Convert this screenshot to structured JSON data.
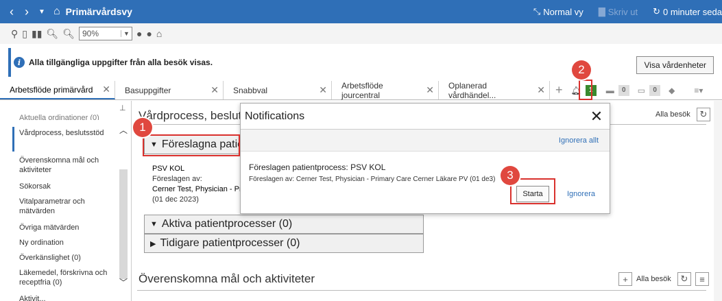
{
  "titlebar": {
    "title": "Primärvårdsvy",
    "normal_view": "Normal vy",
    "print": "Skriv ut",
    "refresh": "0 minuter seda"
  },
  "toolbar": {
    "zoom": "90%"
  },
  "banner": {
    "text": "Alla tillgängliga uppgifter från alla besök visas.",
    "button": "Visa vårdenheter"
  },
  "tabs": [
    {
      "label": "Arbetsflöde primärvård"
    },
    {
      "label": "Basuppgifter"
    },
    {
      "label": "Snabbval"
    },
    {
      "label": "Arbetsflöde jourcentral"
    },
    {
      "label": "Oplanerad vårdhändel..."
    }
  ],
  "tab_counts": {
    "notifications": "1",
    "messages": "0",
    "inbox": "0"
  },
  "sidebar": {
    "items": [
      "Aktuella ordinationer (0)",
      "Vårdprocess, beslutsstöd",
      "Överenskomna mål och aktiviteter",
      "Sökorsak",
      "Vitalparametrar och mätvärden",
      "Övriga mätvärden",
      "Ny ordination",
      "Överkänslighet (0)",
      "Läkemedel, förskrivna och receptfria (0)",
      "Aktivit..."
    ]
  },
  "main": {
    "heading": "Vårdprocess, besluts",
    "alla_besok": "Alla besök",
    "section_suggested": "Föreslagna patie",
    "proposal_name": "PSV KOL",
    "proposal_by_label": "Föreslagen av:",
    "proposal_by": "Cerner Test, Physician - Pri",
    "proposal_date": "(01 dec 2023)",
    "section_active": "Aktiva patientprocesser (0)",
    "section_previous": "Tidigare patientprocesser (0)",
    "heading2": "Överenskomna mål och aktiviteter",
    "alla_besok2": "Alla besök"
  },
  "notification": {
    "title": "Notifications",
    "ignore_all": "Ignorera allt",
    "line1": "Föreslagen patientprocess: PSV KOL",
    "line2": "Föreslagen av: Cerner Test, Physician - Primary Care Cerner Läkare PV (01 de",
    "line2_tail": "3)",
    "start": "Starta",
    "ignore": "Ignorera"
  },
  "markers": [
    "1",
    "2",
    "3"
  ],
  "colors": {
    "accent": "#2f6fb7",
    "highlight": "#d9302c",
    "badge": "#3a8a2e"
  }
}
